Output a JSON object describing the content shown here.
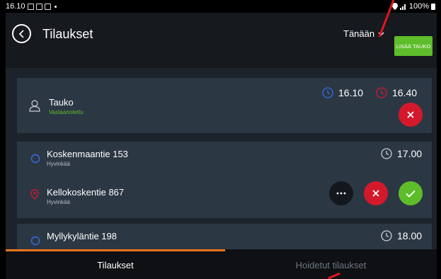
{
  "status_bar": {
    "time": "16.10",
    "battery": "100%"
  },
  "header": {
    "title": "Tilaukset",
    "date_filter": "Tänään",
    "add_pause_label": "LISÄÄ TAUKO"
  },
  "orders": [
    {
      "title": "Tauko",
      "subtitle": "Vastaanotettu",
      "start_time": "16.10",
      "end_time": "16.40"
    },
    {
      "title": "Koskenmaantie 153",
      "subtitle": "Hyvinkää",
      "time": "17.00"
    },
    {
      "title": "Kellokoskentie 867",
      "subtitle": "Hyvinkää"
    },
    {
      "title": "Myllykyläntie 198",
      "time": "18.00"
    }
  ],
  "tabs": [
    {
      "label": "Tilaukset",
      "active": true
    },
    {
      "label": "Hoidetut tilaukset",
      "active": false
    }
  ],
  "colors": {
    "accent_green": "#5ebd2b",
    "accent_red": "#d4192c",
    "active_tab": "#e8761d",
    "annotation": "#e0161e"
  }
}
